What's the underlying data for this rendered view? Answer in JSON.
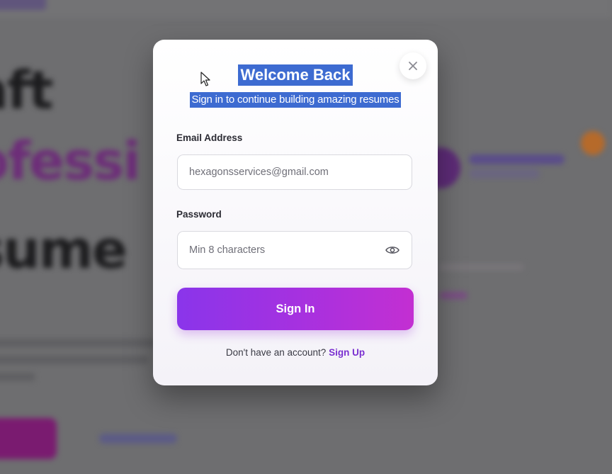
{
  "modal": {
    "title": "Welcome Back",
    "subtitle": "Sign in to continue building amazing resumes",
    "close_icon": "close-icon",
    "email": {
      "label": "Email Address",
      "value": "hexagonsservices@gmail.com"
    },
    "password": {
      "label": "Password",
      "placeholder": "Min 8 characters",
      "toggle_icon": "eye-icon"
    },
    "submit_label": "Sign In",
    "footer_text": "Don't have an account?",
    "footer_link": "Sign Up"
  },
  "colors": {
    "selection_highlight": "#3d6bd1",
    "button_gradient_start": "#8a35ea",
    "button_gradient_end": "#c32fd2",
    "link": "#7a2fd0"
  }
}
